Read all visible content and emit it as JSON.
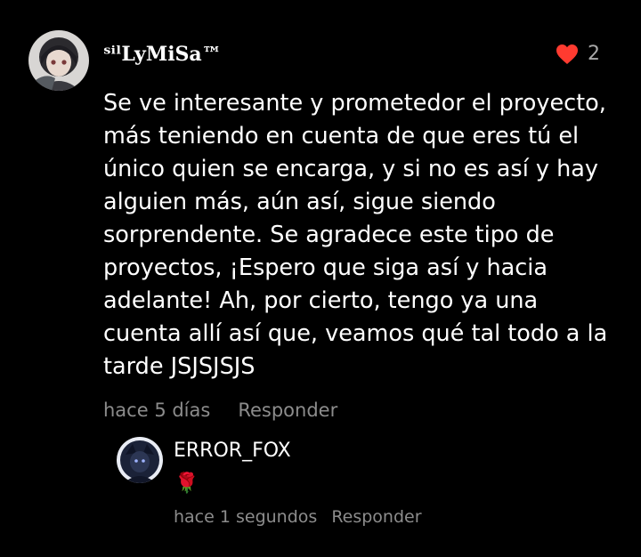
{
  "comment": {
    "username": "ˢⁱˡLyMiSa™",
    "text": "Se ve interesante y prometedor el proyecto, más teniendo en cuenta de que eres tú el único quien se encarga, y si no es así y hay alguien más, aún así, sigue siendo sorprendente. Se agradece este tipo de proyectos, ¡Espero que siga así y hacia adelante! Ah, por cierto, tengo ya una cuenta allí así que, veamos qué tal todo a la tarde JSJSJSJS",
    "likes": "2",
    "like_icon": "heart-icon",
    "time": "hace 5 días",
    "reply_label": "Responder"
  },
  "reply": {
    "username": "ERROR_FOX",
    "text": "🌹",
    "time": "hace 1 segundos",
    "reply_label": "Responder"
  },
  "colors": {
    "background": "#000000",
    "text": "#ffffff",
    "muted": "#8c8c8c",
    "heart": "#ff3b30"
  }
}
